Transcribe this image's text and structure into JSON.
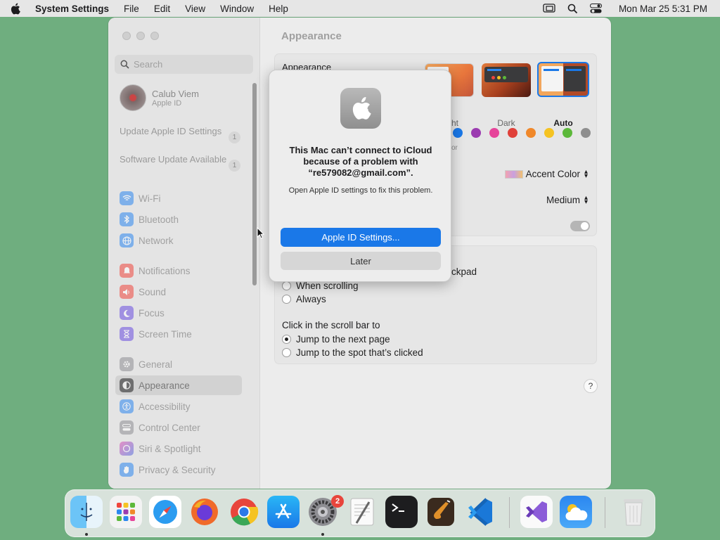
{
  "menubar": {
    "app_name": "System Settings",
    "menus": [
      "File",
      "Edit",
      "View",
      "Window",
      "Help"
    ],
    "clock": "Mon Mar 25  5:31 PM"
  },
  "sidebar": {
    "search_placeholder": "Search",
    "profile": {
      "name": "Calub Viem",
      "sub": "Apple ID"
    },
    "notices": [
      {
        "label": "Update Apple ID Settings",
        "count": "1"
      },
      {
        "label": "Software Update Available",
        "count": "1"
      }
    ],
    "items": [
      {
        "label": "Wi-Fi",
        "icon": "wifi-icon",
        "color": "#2b87f0"
      },
      {
        "label": "Bluetooth",
        "icon": "bluetooth-icon",
        "color": "#2b87f0"
      },
      {
        "label": "Network",
        "icon": "globe-icon",
        "color": "#2b87f0"
      },
      {
        "label": "Notifications",
        "icon": "bell-icon",
        "color": "#f0453c"
      },
      {
        "label": "Sound",
        "icon": "speaker-icon",
        "color": "#f0453c"
      },
      {
        "label": "Focus",
        "icon": "moon-icon",
        "color": "#6a4ce0"
      },
      {
        "label": "Screen Time",
        "icon": "hourglass-icon",
        "color": "#6a4ce0"
      },
      {
        "label": "General",
        "icon": "gear-icon",
        "color": "#8e8e93"
      },
      {
        "label": "Appearance",
        "icon": "appearance-icon",
        "color": "#1d1d1f"
      },
      {
        "label": "Accessibility",
        "icon": "accessibility-icon",
        "color": "#2b87f0"
      },
      {
        "label": "Control Center",
        "icon": "control-center-icon",
        "color": "#8e8e93"
      },
      {
        "label": "Siri & Spotlight",
        "icon": "siri-icon",
        "color": "#b04ad8"
      },
      {
        "label": "Privacy & Security",
        "icon": "hand-icon",
        "color": "#2b87f0"
      }
    ]
  },
  "content": {
    "title": "Appearance",
    "appearance_label": "Appearance",
    "modes": [
      {
        "label": "Light"
      },
      {
        "label": "Dark"
      },
      {
        "label": "Auto"
      }
    ],
    "light_label_partial": "ht",
    "accent_partial": "or",
    "accent_colors": [
      "#1a78e8",
      "#9b3bb0",
      "#e6449a",
      "#e0413a",
      "#f0882a",
      "#f5c322",
      "#5cb83a",
      "#8e8e8e"
    ],
    "highlight_value": "Accent Color",
    "sidebar_icon_size": "Medium",
    "scroll_partial": "ckpad",
    "show_scroll_options": [
      {
        "label": "When scrolling",
        "selected": false
      },
      {
        "label": "Always",
        "selected": false
      }
    ],
    "click_scroll_label": "Click in the scroll bar to",
    "click_scroll_options": [
      {
        "label": "Jump to the next page",
        "selected": true
      },
      {
        "label": "Jump to the spot that’s clicked",
        "selected": false
      }
    ],
    "help": "?"
  },
  "alert": {
    "title": "This Mac can’t connect to iCloud because of a problem with “re579082@gmail.com”.",
    "message": "Open Apple ID settings to fix this problem.",
    "primary_button": "Apple ID Settings...",
    "secondary_button": "Later"
  },
  "dock": {
    "apps": [
      "Finder",
      "Launchpad",
      "Safari",
      "Firefox",
      "Chrome",
      "App Store",
      "System Settings",
      "TextEdit",
      "Terminal",
      "GarageBand",
      "Visual Studio Code",
      "Visual Studio",
      "Weather",
      "Trash"
    ],
    "system_settings_badge": "2"
  }
}
